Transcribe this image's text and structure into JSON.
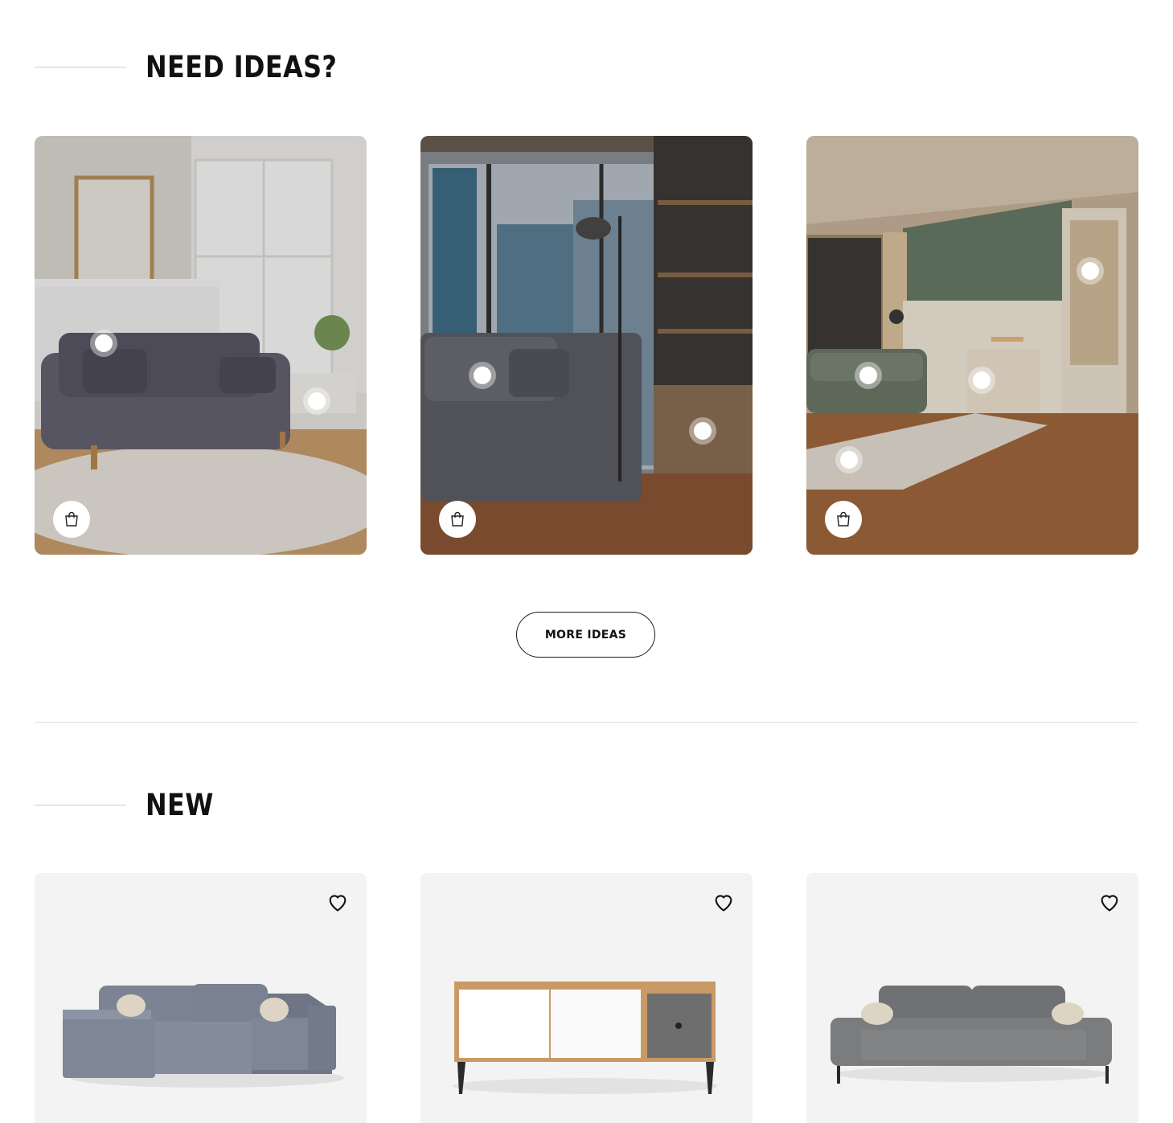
{
  "ideas_section": {
    "title": "NEED IDEAS?",
    "cards": [
      {
        "scene": "living room with grey sofa and fireplace",
        "hotspots": 2
      },
      {
        "scene": "city apartment with corduroy sofa and shelving",
        "hotspots": 2
      },
      {
        "scene": "green-walled living room with sage sofa and cabinet",
        "hotspots": 4
      }
    ],
    "shop_icon": "shopping-bag-icon",
    "more_button": "MORE IDEAS"
  },
  "new_section": {
    "title": "NEW",
    "products": [
      {
        "kind": "sofa",
        "favorite_icon": "heart-icon"
      },
      {
        "kind": "tv-stand",
        "favorite_icon": "heart-icon"
      },
      {
        "kind": "sofa",
        "favorite_icon": "heart-icon"
      }
    ]
  },
  "colors": {
    "text": "#111111",
    "card_bg": "#f3f3f3",
    "divider": "#e4e4e4"
  }
}
